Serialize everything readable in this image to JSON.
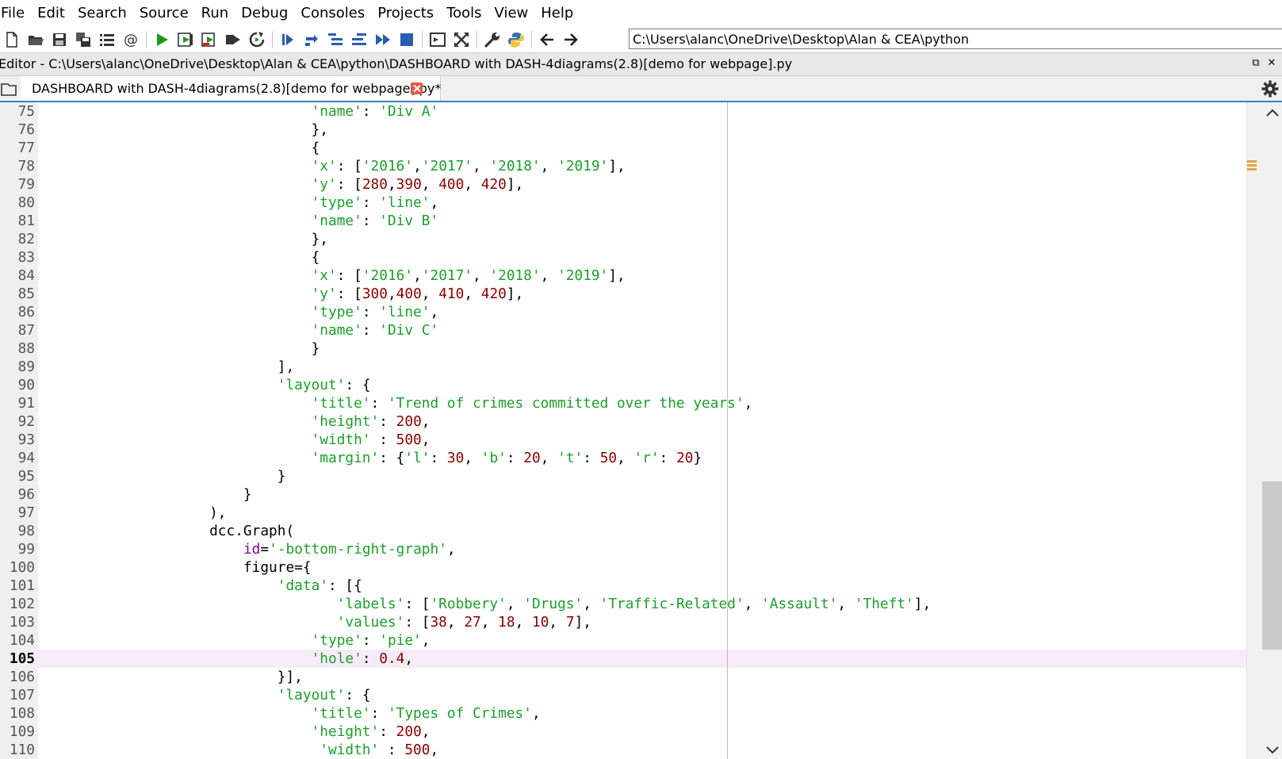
{
  "menu": [
    "File",
    "Edit",
    "Search",
    "Source",
    "Run",
    "Debug",
    "Consoles",
    "Projects",
    "Tools",
    "View",
    "Help"
  ],
  "toolbar": {
    "path": "C:\\Users\\alanc\\OneDrive\\Desktop\\Alan & CEA\\python"
  },
  "editor": {
    "title": "Editor - C:\\Users\\alanc\\OneDrive\\Desktop\\Alan & CEA\\python\\DASHBOARD with DASH-4diagrams(2.8)[demo for webpage].py",
    "undock": "⧉",
    "close": "✕"
  },
  "tab": {
    "label": "DASHBOARD with DASH-4diagrams(2.8)[demo for webpage].py*"
  },
  "code": {
    "lines": [
      {
        "no": "75",
        "text": "                                'name': 'Div A'"
      },
      {
        "no": "76",
        "text": "                                },"
      },
      {
        "no": "77",
        "text": "                                {"
      },
      {
        "no": "78",
        "text": "                                'x': ['2016','2017', '2018', '2019'],"
      },
      {
        "no": "79",
        "text": "                                'y': [280,390, 400, 420],"
      },
      {
        "no": "80",
        "text": "                                'type': 'line',"
      },
      {
        "no": "81",
        "text": "                                'name': 'Div B'"
      },
      {
        "no": "82",
        "text": "                                },"
      },
      {
        "no": "83",
        "text": "                                {"
      },
      {
        "no": "84",
        "text": "                                'x': ['2016','2017', '2018', '2019'],"
      },
      {
        "no": "85",
        "text": "                                'y': [300,400, 410, 420],"
      },
      {
        "no": "86",
        "text": "                                'type': 'line',"
      },
      {
        "no": "87",
        "text": "                                'name': 'Div C'"
      },
      {
        "no": "88",
        "text": "                                }"
      },
      {
        "no": "89",
        "text": "                            ],"
      },
      {
        "no": "90",
        "text": "                            'layout': {"
      },
      {
        "no": "91",
        "text": "                                'title': 'Trend of crimes committed over the years',"
      },
      {
        "no": "92",
        "text": "                                'height': 200,"
      },
      {
        "no": "93",
        "text": "                                'width' : 500,"
      },
      {
        "no": "94",
        "text": "                                'margin': {'l': 30, 'b': 20, 't': 50, 'r': 20}"
      },
      {
        "no": "95",
        "text": "                            }"
      },
      {
        "no": "96",
        "text": "                        }"
      },
      {
        "no": "97",
        "text": "                    ),"
      },
      {
        "no": "98",
        "text": "                    dcc.Graph("
      },
      {
        "no": "99",
        "text": "                        id='-bottom-right-graph',"
      },
      {
        "no": "100",
        "text": "                        figure={"
      },
      {
        "no": "101",
        "text": "                            'data': [{"
      },
      {
        "no": "102",
        "text": "                                   'labels': ['Robbery', 'Drugs', 'Traffic-Related', 'Assault', 'Theft'],"
      },
      {
        "no": "103",
        "text": "                                   'values': [38, 27, 18, 10, 7],"
      },
      {
        "no": "104",
        "text": "                                'type': 'pie',"
      },
      {
        "no": "105",
        "text": "                                'hole': 0.4,"
      },
      {
        "no": "106",
        "text": "                            }],"
      },
      {
        "no": "107",
        "text": "                            'layout': {"
      },
      {
        "no": "108",
        "text": "                                'title': 'Types of Crimes',"
      },
      {
        "no": "109",
        "text": "                                'height': 200,"
      },
      {
        "no": "110",
        "text": "                                 'width' : 500,"
      }
    ],
    "current_line": "105"
  },
  "colors": {
    "string": "#1aa128",
    "number": "#8b0000",
    "keyword_arg": "#8b008b",
    "current_line_bg": "#f7ebf7",
    "tab_underline": "#3b7fc4"
  },
  "icons": [
    "new-file-icon",
    "open-file-icon",
    "save-icon",
    "save-all-icon",
    "outline-icon",
    "at-icon",
    "run-icon",
    "run-cell-icon",
    "run-cell-advance-icon",
    "run-selection-icon",
    "rerun-icon",
    "debug-icon",
    "step-icon",
    "step-into-icon",
    "step-return-icon",
    "continue-icon",
    "stop-icon",
    "maximize-pane-icon",
    "fullscreen-icon",
    "wrench-icon",
    "python-icon",
    "back-arrow-icon",
    "forward-arrow-icon",
    "gear-icon",
    "close-tab-icon"
  ]
}
